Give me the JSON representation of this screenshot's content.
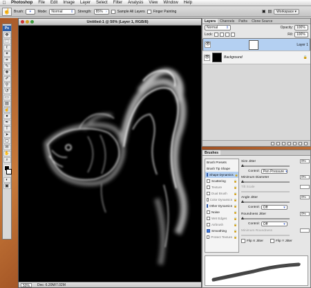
{
  "menubar": {
    "app": "Photoshop",
    "items": [
      "File",
      "Edit",
      "Image",
      "Layer",
      "Select",
      "Filter",
      "Analysis",
      "View",
      "Window",
      "Help"
    ]
  },
  "options": {
    "brush_label": "Brush:",
    "mode_label": "Mode:",
    "mode_value": "Normal",
    "strength_label": "Strength:",
    "strength_value": "85%",
    "sample_all": "Sample All Layers",
    "finger": "Finger Painting",
    "workspace": "Workspace"
  },
  "document": {
    "title": "Untitled-1 @ 50% (Layer 1, RGB/8)",
    "zoom": "50%",
    "doc_info": "Doc: 6.20M/7.02M"
  },
  "layers": {
    "tabs": [
      "Layers",
      "Channels",
      "Paths",
      "Clone Source"
    ],
    "blend": "Normal",
    "opacity_label": "Opacity:",
    "opacity": "100%",
    "lock_label": "Lock:",
    "fill_label": "Fill:",
    "fill": "100%",
    "items": [
      "Layer 1",
      "Background"
    ]
  },
  "brushes": {
    "tab": "Brushes",
    "list": [
      {
        "label": "Brush Presets",
        "enabled": true,
        "checked": false,
        "lock": false,
        "hl": false
      },
      {
        "label": "Brush Tip Shape",
        "enabled": true,
        "checked": false,
        "lock": false,
        "hl": false
      },
      {
        "label": "Shape Dynamics",
        "enabled": true,
        "checked": true,
        "lock": true,
        "hl": true
      },
      {
        "label": "Scattering",
        "enabled": true,
        "checked": false,
        "lock": true,
        "hl": false
      },
      {
        "label": "Texture",
        "enabled": false,
        "checked": false,
        "lock": true,
        "hl": false
      },
      {
        "label": "Dual Brush",
        "enabled": false,
        "checked": false,
        "lock": true,
        "hl": false
      },
      {
        "label": "Color Dynamics",
        "enabled": false,
        "checked": false,
        "lock": true,
        "hl": false
      },
      {
        "label": "Other Dynamics",
        "enabled": true,
        "checked": true,
        "lock": true,
        "hl": false
      },
      {
        "label": "Noise",
        "enabled": true,
        "checked": false,
        "lock": true,
        "hl": false
      },
      {
        "label": "Wet Edges",
        "enabled": false,
        "checked": false,
        "lock": true,
        "hl": false
      },
      {
        "label": "Airbrush",
        "enabled": false,
        "checked": false,
        "lock": true,
        "hl": false
      },
      {
        "label": "Smoothing",
        "enabled": true,
        "checked": true,
        "lock": true,
        "hl": false
      },
      {
        "label": "Protect Texture",
        "enabled": false,
        "checked": false,
        "lock": true,
        "hl": false
      }
    ],
    "size_jitter_label": "Size Jitter",
    "size_jitter": "0%",
    "control_label": "Control:",
    "control1": "Pen Pressure",
    "min_diam_label": "Minimum Diameter",
    "min_diam": "0%",
    "tilt_scale_label": "Tilt Scale",
    "angle_jitter_label": "Angle Jitter",
    "angle_jitter": "0%",
    "control2": "Off",
    "roundness_jitter_label": "Roundness Jitter",
    "roundness_jitter": "0%",
    "control3": "Off",
    "min_round_label": "Minimum Roundness",
    "flip_x": "Flip X Jitter",
    "flip_y": "Flip Y Jitter"
  }
}
